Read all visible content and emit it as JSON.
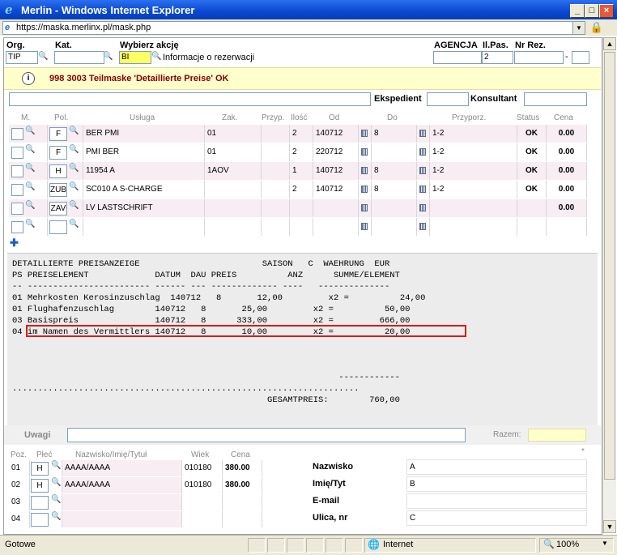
{
  "window": {
    "title": "Merlin - Windows Internet Explorer",
    "url": "https://maska.merlinx.pl/mask.php"
  },
  "header": {
    "org_label": "Org.",
    "org_value": "TIP",
    "kat_label": "Kat.",
    "kat_value": "",
    "akcja_label": "Wybierz akcję",
    "akcja_value": "BI",
    "akcja_desc": "Informacje o rezerwacji",
    "agencja_label": "AGENCJA",
    "agencja_value": "",
    "ilpas_label": "Il.Pas.",
    "ilpas_value": "2",
    "nrrez_label": "Nr Rez.",
    "nrrez_value": "",
    "nrrez_sep": "-",
    "nrrez_suffix": ""
  },
  "message": {
    "text": "998 3003 Teilmaske 'Detaillierte Preise' OK"
  },
  "staff": {
    "ekspedient_label": "Ekspedient",
    "konsultant_label": "Konsultant"
  },
  "services": {
    "columns": [
      "M.",
      "Pol.",
      "Usługa",
      "Zak.",
      "Przyp.",
      "Ilość",
      "Od",
      "Do",
      "Przyporz.",
      "Status",
      "Cena"
    ],
    "rows": [
      {
        "pol": "F",
        "usluga": "BER PMI",
        "zak": "01",
        "przyp": "",
        "ilosc": "2",
        "od": "140712",
        "do": "8",
        "przyporz": "1-2",
        "status": "OK",
        "cena": "0.00"
      },
      {
        "pol": "F",
        "usluga": "PMI BER",
        "zak": "01",
        "przyp": "",
        "ilosc": "2",
        "od": "220712",
        "do": "",
        "przyporz": "1-2",
        "status": "OK",
        "cena": "0.00"
      },
      {
        "pol": "H",
        "usluga": "11954 A",
        "zak": "1AOV",
        "przyp": "",
        "ilosc": "1",
        "od": "140712",
        "do": "8",
        "przyporz": "1-2",
        "status": "OK",
        "cena": "0.00"
      },
      {
        "pol": "ZUB",
        "usluga": "SC010 A S-CHARGE",
        "zak": "",
        "przyp": "",
        "ilosc": "2",
        "od": "140712",
        "do": "8",
        "przyporz": "1-2",
        "status": "OK",
        "cena": "0.00"
      },
      {
        "pol": "ZAV",
        "usluga": "LV LASTSCHRIFT",
        "zak": "",
        "przyp": "",
        "ilosc": "",
        "od": "",
        "do": "",
        "przyporz": "",
        "status": "",
        "cena": "0.00"
      },
      {
        "pol": "",
        "usluga": "",
        "zak": "",
        "przyp": "",
        "ilosc": "",
        "od": "",
        "do": "",
        "przyporz": "",
        "status": "",
        "cena": ""
      }
    ]
  },
  "preis": {
    "lines": [
      "DETAILLIERTE PREISANZEIGE                        SAISON   C  WAEHRUNG  EUR",
      "PS PREISELEMENT             DATUM  DAU PREIS          ANZ      SUMME/ELEMENT",
      "-- ------------------------ ------ --- ------------- ----   --------------",
      "01 Mehrkosten Kerosinzuschlag  140712   8       12,00         x2 =          24,00",
      "01 Flughafenzuschlag        140712   8       25,00         x2 =          50,00",
      "03 Basispreis               140712   8      333,00         x2 =         666,00",
      "04 im Namen des Vermittlers 140712   8       10,00         x2 =          20,00",
      "",
      "",
      "",
      "                                                                ------------",
      "....................................................................",
      "                                                  GESAMTPREIS:        760,00"
    ]
  },
  "uwagi": {
    "label": "Uwagi",
    "razem_label": "Razem:",
    "razem_value": ""
  },
  "passengers": {
    "columns": [
      "Poz.",
      "Płeć",
      "Nazwisko/Imię/Tytuł",
      "Wiek",
      "Cena"
    ],
    "rows": [
      {
        "poz": "01",
        "plec": "H",
        "name": "AAAA/AAAA",
        "wiek": "010180",
        "cena": "380.00"
      },
      {
        "poz": "02",
        "plec": "H",
        "name": "AAAA/AAAA",
        "wiek": "010180",
        "cena": "380.00"
      },
      {
        "poz": "03",
        "plec": "",
        "name": "",
        "wiek": "",
        "cena": ""
      },
      {
        "poz": "04",
        "plec": "",
        "name": "",
        "wiek": "",
        "cena": ""
      }
    ],
    "star": "*"
  },
  "details": {
    "fields": [
      {
        "label": "Nazwisko",
        "value": "A"
      },
      {
        "label": "Imię/Tyt",
        "value": "B"
      },
      {
        "label": "E-mail",
        "value": ""
      },
      {
        "label": "Ulica, nr",
        "value": "C"
      }
    ]
  },
  "status": {
    "text": "Gotowe",
    "zone": "Internet",
    "zoom": "100%"
  }
}
